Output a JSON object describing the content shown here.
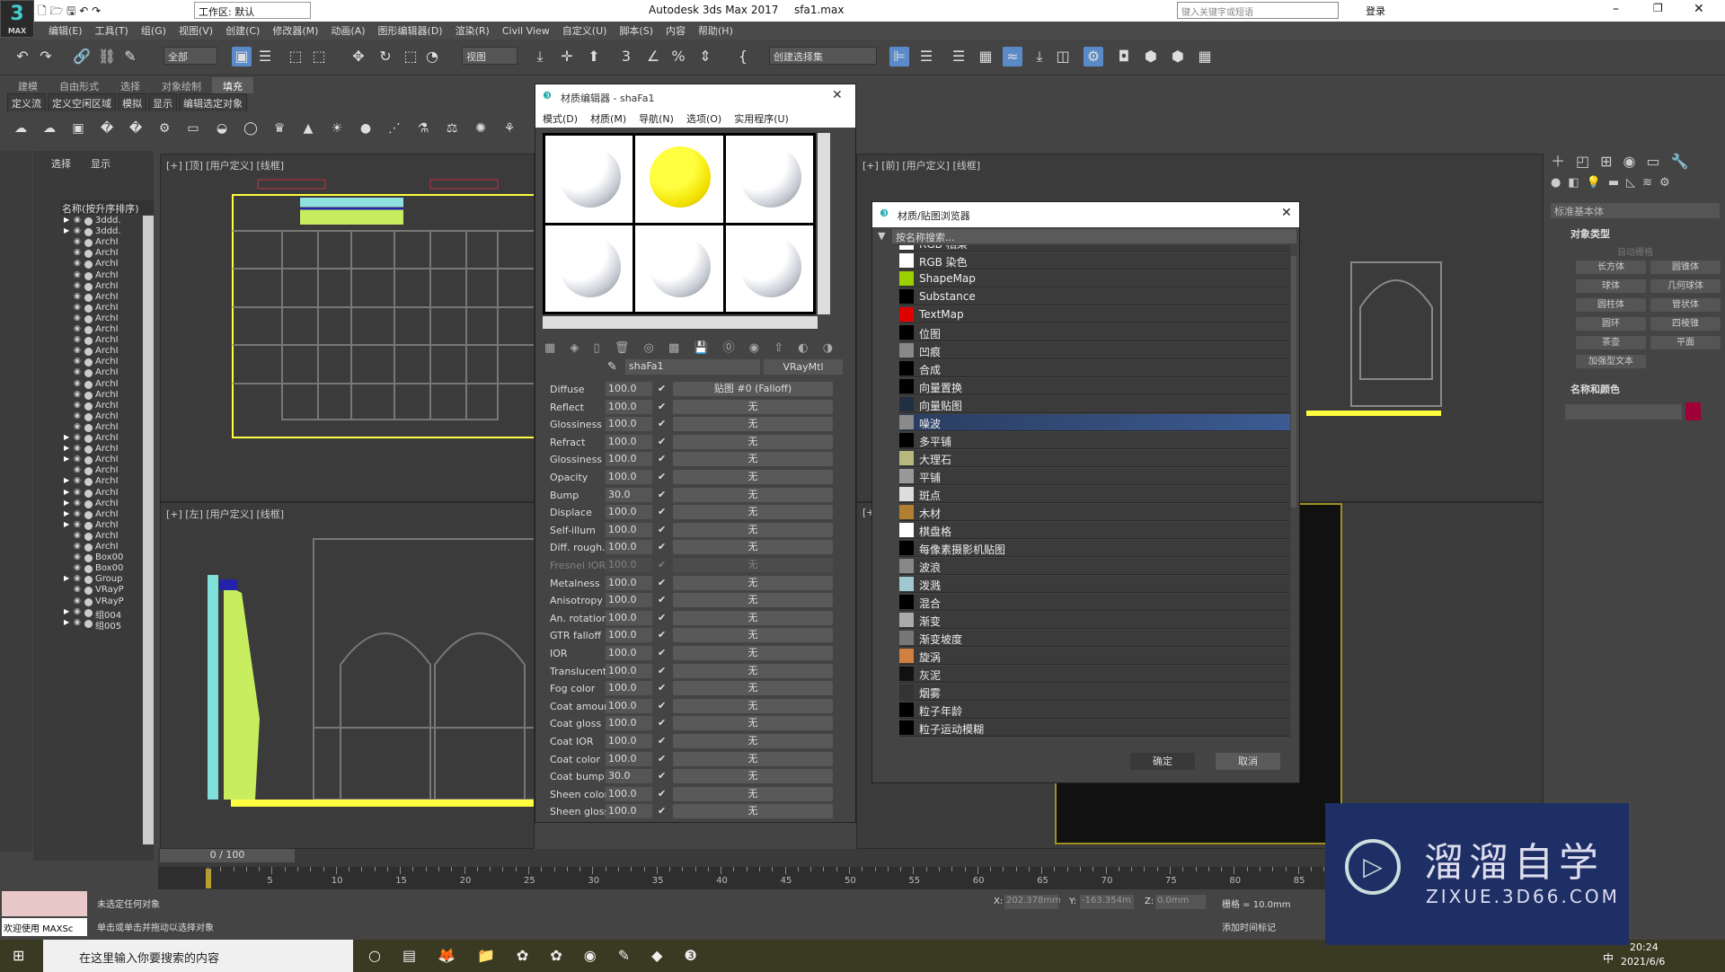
{
  "titlebar": {
    "app": "Autodesk 3ds Max 2017",
    "file": "sfa1.max",
    "workspace": "工作区: 默认",
    "search_placeholder": "键入关键字或短语",
    "login": "登录",
    "logo": "3",
    "logo_sub": "MAX"
  },
  "menu": [
    "编辑(E)",
    "工具(T)",
    "组(G)",
    "视图(V)",
    "创建(C)",
    "修改器(M)",
    "动画(A)",
    "图形编辑器(D)",
    "渲染(R)",
    "Civil View",
    "自定义(U)",
    "脚本(S)",
    "内容",
    "帮助(H)"
  ],
  "toolbar": {
    "filter": "全部",
    "view": "视图",
    "selset": "创建选择集"
  },
  "ribbon": {
    "tabs": [
      "建模",
      "自由形式",
      "选择",
      "对象绘制",
      "填充"
    ],
    "active": "填充",
    "row2": [
      "定义流",
      "定义空闲区域",
      "模拟",
      "显示",
      "编辑选定对象"
    ]
  },
  "explorer": {
    "tabs": [
      "选择",
      "显示"
    ],
    "header": "名称(按升序排序)",
    "items": [
      {
        "n": "3ddd.",
        "e": true
      },
      {
        "n": "3ddd.",
        "e": true
      },
      {
        "n": "ArchI"
      },
      {
        "n": "ArchI"
      },
      {
        "n": "ArchI"
      },
      {
        "n": "ArchI"
      },
      {
        "n": "ArchI"
      },
      {
        "n": "ArchI"
      },
      {
        "n": "ArchI"
      },
      {
        "n": "ArchI"
      },
      {
        "n": "ArchI"
      },
      {
        "n": "ArchI"
      },
      {
        "n": "ArchI"
      },
      {
        "n": "ArchI"
      },
      {
        "n": "ArchI"
      },
      {
        "n": "ArchI"
      },
      {
        "n": "ArchI"
      },
      {
        "n": "ArchI"
      },
      {
        "n": "ArchI"
      },
      {
        "n": "ArchI"
      },
      {
        "n": "ArchI",
        "e": true
      },
      {
        "n": "ArchI",
        "e": true
      },
      {
        "n": "ArchI",
        "e": true
      },
      {
        "n": "ArchI"
      },
      {
        "n": "ArchI",
        "e": true
      },
      {
        "n": "ArchI",
        "e": true
      },
      {
        "n": "ArchI",
        "e": true
      },
      {
        "n": "ArchI",
        "e": true
      },
      {
        "n": "ArchI",
        "e": true
      },
      {
        "n": "ArchI"
      },
      {
        "n": "ArchI"
      },
      {
        "n": "Box00"
      },
      {
        "n": "Box00"
      },
      {
        "n": "Group",
        "e": true
      },
      {
        "n": "VRayP"
      },
      {
        "n": "VRayP"
      },
      {
        "n": "组004",
        "e": true
      },
      {
        "n": "组005",
        "e": true
      }
    ]
  },
  "viewports": {
    "top": "[+] [顶] [用户定义] [线框]",
    "left": "[+] [左] [用户定义] [线框]",
    "front": "[+] [前] [用户定义] [线框]",
    "persp": "[+]"
  },
  "material_editor": {
    "title": "材质编辑器 - shaFa1",
    "menu": [
      "模式(D)",
      "材质(M)",
      "导航(N)",
      "选项(O)",
      "实用程序(U)"
    ],
    "material_name": "shaFa1",
    "material_type": "VRayMtl",
    "params": [
      {
        "l": "Diffuse",
        "v": "100.0",
        "m": "贴图 #0 (Falloff)"
      },
      {
        "l": "Reflect",
        "v": "100.0",
        "m": "无"
      },
      {
        "l": "Glossiness",
        "v": "100.0",
        "m": "无"
      },
      {
        "l": "Refract",
        "v": "100.0",
        "m": "无"
      },
      {
        "l": "Glossiness",
        "v": "100.0",
        "m": "无"
      },
      {
        "l": "Opacity",
        "v": "100.0",
        "m": "无"
      },
      {
        "l": "Bump",
        "v": "30.0",
        "m": "无"
      },
      {
        "l": "Displace",
        "v": "100.0",
        "m": "无"
      },
      {
        "l": "Self-illum",
        "v": "100.0",
        "m": "无"
      },
      {
        "l": "Diff. rough.",
        "v": "100.0",
        "m": "无"
      },
      {
        "l": "Fresnel IOR",
        "v": "100.0",
        "m": "无",
        "disabled": true
      },
      {
        "l": "Metalness",
        "v": "100.0",
        "m": "无"
      },
      {
        "l": "Anisotropy",
        "v": "100.0",
        "m": "无"
      },
      {
        "l": "An. rotation",
        "v": "100.0",
        "m": "无"
      },
      {
        "l": "GTR falloff",
        "v": "100.0",
        "m": "无"
      },
      {
        "l": "IOR",
        "v": "100.0",
        "m": "无"
      },
      {
        "l": "Translucent",
        "v": "100.0",
        "m": "无"
      },
      {
        "l": "Fog color",
        "v": "100.0",
        "m": "无"
      },
      {
        "l": "Coat amoun",
        "v": "100.0",
        "m": "无"
      },
      {
        "l": "Coat gloss",
        "v": "100.0",
        "m": "无"
      },
      {
        "l": "Coat IOR",
        "v": "100.0",
        "m": "无"
      },
      {
        "l": "Coat color",
        "v": "100.0",
        "m": "无"
      },
      {
        "l": "Coat bump",
        "v": "30.0",
        "m": "无"
      },
      {
        "l": "Sheen color",
        "v": "100.0",
        "m": "无"
      },
      {
        "l": "Sheen gloss",
        "v": "100.0",
        "m": "无"
      }
    ]
  },
  "browser": {
    "title": "材质/贴图浏览器",
    "search_placeholder": "按名称搜索...",
    "ok": "确定",
    "cancel": "取消",
    "selected": "噪波",
    "items": [
      {
        "n": "RGB 相乘",
        "c": "#ffffff"
      },
      {
        "n": "RGB 染色",
        "c": "#ffffff"
      },
      {
        "n": "ShapeMap",
        "c": "#9ad000"
      },
      {
        "n": "Substance",
        "c": "#000000"
      },
      {
        "n": "TextMap",
        "c": "#e00000"
      },
      {
        "n": "位图",
        "c": "#000000"
      },
      {
        "n": "凹痕",
        "c": "#888888"
      },
      {
        "n": "合成",
        "c": "#000000"
      },
      {
        "n": "向量置换",
        "c": "#000000"
      },
      {
        "n": "向量贴图",
        "c": "#203040"
      },
      {
        "n": "噪波",
        "c": "#8a8a8a"
      },
      {
        "n": "多平铺",
        "c": "#000000"
      },
      {
        "n": "大理石",
        "c": "#b8b880"
      },
      {
        "n": "平铺",
        "c": "#999999"
      },
      {
        "n": "斑点",
        "c": "#dddddd"
      },
      {
        "n": "木材",
        "c": "#b08030"
      },
      {
        "n": "棋盘格",
        "c": "#ffffff"
      },
      {
        "n": "每像素摄影机贴图",
        "c": "#000000"
      },
      {
        "n": "波浪",
        "c": "#888888"
      },
      {
        "n": "泼溅",
        "c": "#a0c8d0"
      },
      {
        "n": "混合",
        "c": "#000000"
      },
      {
        "n": "渐变",
        "c": "#aaaaaa"
      },
      {
        "n": "渐变坡度",
        "c": "#777777"
      },
      {
        "n": "旋涡",
        "c": "#d08040"
      },
      {
        "n": "灰泥",
        "c": "#111111"
      },
      {
        "n": "烟雾",
        "c": "#333333"
      },
      {
        "n": "粒子年龄",
        "c": "#000000"
      },
      {
        "n": "粒子运动模糊",
        "c": "#000000"
      }
    ]
  },
  "command_panel": {
    "category": "标准基本体",
    "rollout1": "对象类型",
    "autogrid": "自动栅格",
    "buttons": [
      "长方体",
      "圆锥体",
      "球体",
      "几何球体",
      "圆柱体",
      "管状体",
      "圆环",
      "四棱锥",
      "茶壶",
      "平面",
      "加强型文本"
    ],
    "rollout2": "名称和颜色",
    "color": "#a0003a"
  },
  "timeline": {
    "frame": "0 / 100",
    "ticks": [
      "5",
      "10",
      "15",
      "20",
      "25",
      "30",
      "35",
      "40",
      "45",
      "50",
      "55",
      "60",
      "65",
      "70",
      "75",
      "80",
      "85"
    ]
  },
  "status": {
    "welcome": "欢迎使用 MAXSc",
    "line1": "未选定任何对象",
    "line2": "单击或单击并拖动以选择对象",
    "x": "202.378mm",
    "y": "-163.354m",
    "z": "0.0mm",
    "grid": "栅格 = 10.0mm",
    "addtime": "添加时间标记"
  },
  "taskbar": {
    "search": "在这里输入你要搜索的内容",
    "time": "20:24",
    "date": "2021/6/6",
    "ime": "中"
  },
  "watermark": {
    "name": "溜溜自学",
    "url": "ZIXUE.3D66.COM"
  }
}
